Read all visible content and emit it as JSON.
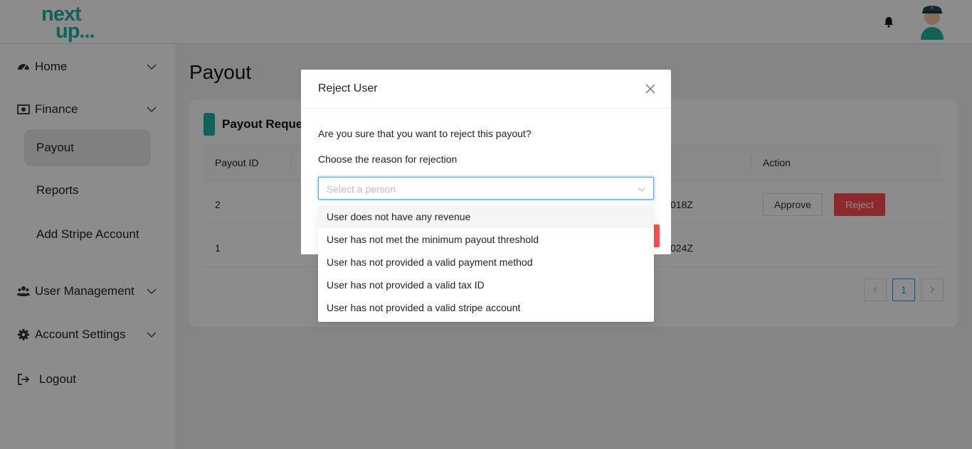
{
  "header": {
    "logo_line1": "next",
    "logo_line2": "up...",
    "notification_icon": "bell-icon",
    "avatar_icon": "user-avatar"
  },
  "sidebar": {
    "items": [
      {
        "label": "Home",
        "icon": "dashboard-icon"
      },
      {
        "label": "Finance",
        "icon": "money-icon"
      },
      {
        "label": "User Management",
        "icon": "users-icon"
      },
      {
        "label": "Account Settings",
        "icon": "gear-icon"
      },
      {
        "label": "Logout",
        "icon": "logout-icon"
      }
    ],
    "finance_sub": [
      "Payout",
      "Reports",
      "Add Stripe Account"
    ],
    "active_sub": "Payout"
  },
  "page": {
    "title": "Payout",
    "card_title": "Payout Reques",
    "columns": [
      "Payout ID",
      "Action"
    ],
    "rows": [
      {
        "id": "2",
        "date_fragment": "018Z",
        "approve": "Approve",
        "reject": "Reject"
      },
      {
        "id": "1",
        "date_fragment": "024Z"
      }
    ],
    "pagination": {
      "current": "1"
    }
  },
  "modal": {
    "title": "Reject User",
    "question": "Are you sure that you want to reject this payout?",
    "reason_label": "Choose the reason for rejection",
    "select_placeholder": "Select a person",
    "options": [
      "User does not have any revenue",
      "User has not met the minimum payout threshold",
      "User has not provided a valid payment method",
      "User has not provided a valid tax ID",
      "User has not provided a valid stripe account"
    ]
  },
  "colors": {
    "brand": "#1cb5a3",
    "danger": "#ff4d4f",
    "focus": "#40a9ff"
  }
}
